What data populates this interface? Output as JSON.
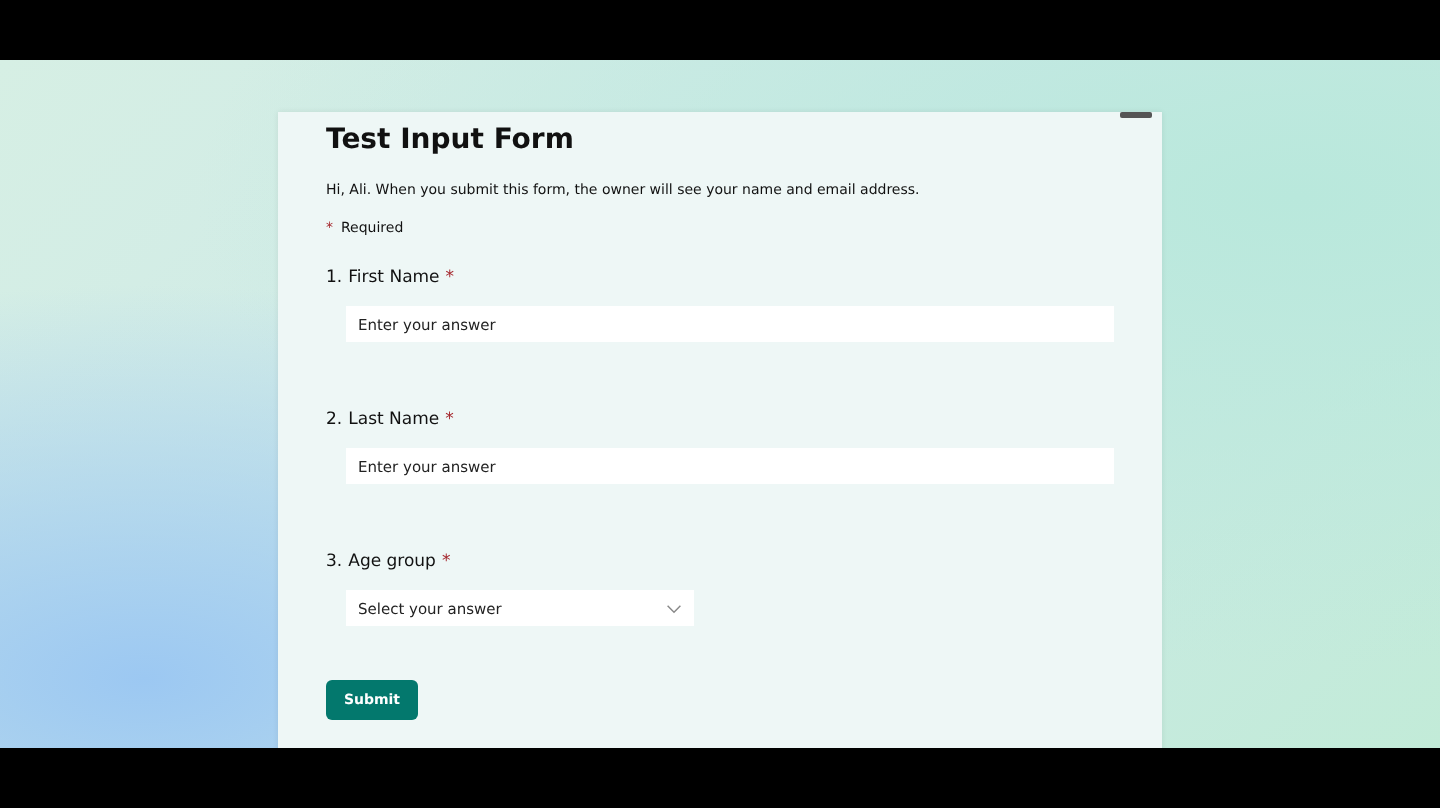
{
  "form": {
    "title": "Test Input Form",
    "intro": "Hi, Ali. When you submit this form, the owner will see your name and email address.",
    "required_legend": {
      "mark": "*",
      "label": "Required"
    },
    "questions": [
      {
        "number": "1.",
        "label": "First Name",
        "required_mark": "*",
        "kind": "text",
        "placeholder": "Enter your answer"
      },
      {
        "number": "2.",
        "label": "Last Name",
        "required_mark": "*",
        "kind": "text",
        "placeholder": "Enter your answer"
      },
      {
        "number": "3.",
        "label": "Age group",
        "required_mark": "*",
        "kind": "choice",
        "placeholder": "Select your answer"
      }
    ],
    "submit": "Submit"
  }
}
